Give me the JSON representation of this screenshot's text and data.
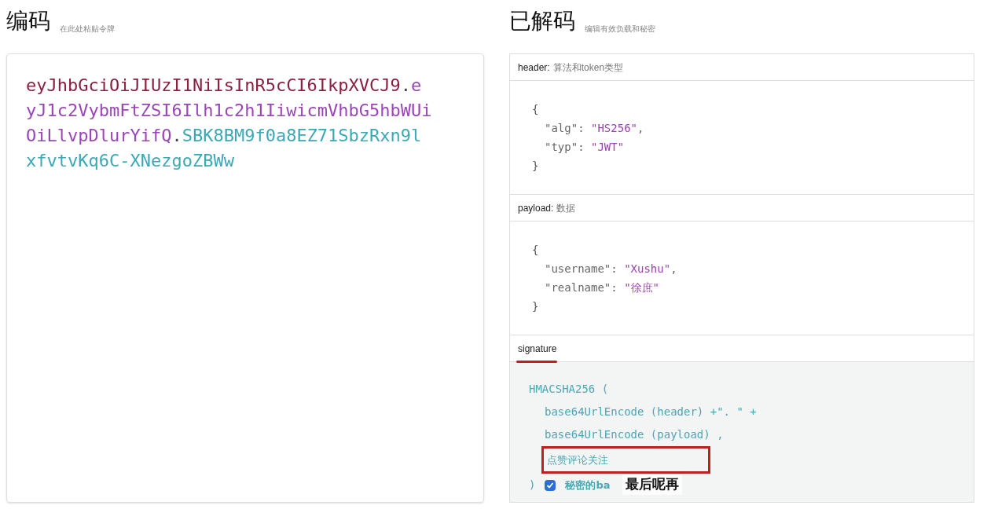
{
  "encoded": {
    "title": "编码",
    "hint": "在此处粘贴令牌",
    "token_parts": [
      {
        "kind": "header",
        "text": "eyJhbGciOiJIUzI1NiIsInR5cCI6IkpXVCJ9"
      },
      {
        "kind": "dot",
        "text": "."
      },
      {
        "kind": "payload",
        "text": "eyJ1c2VybmFtZSI6Ilh1c2h1IiwicmVhbG5hbWUiOiLlvpDlurYifQ"
      },
      {
        "kind": "dot",
        "text": "."
      },
      {
        "kind": "signature",
        "text": "SBK8BM9f0a8EZ71SbzRxn9lxfvtvKq6C-XNezgoZBWw"
      }
    ]
  },
  "decoded": {
    "title": "已解码",
    "hint": "编辑有效负载和秘密",
    "sections": [
      {
        "kind": "json",
        "label": "header:",
        "hint": "算法和token类型",
        "underlined": false,
        "lines": [
          {
            "kind": "brace",
            "text": "{"
          },
          {
            "kind": "entry",
            "key": "\"alg\"",
            "sep": ": ",
            "value": "\"HS256\"",
            "end": ","
          },
          {
            "kind": "entry",
            "key": "\"typ\"",
            "sep": ": ",
            "value": "\"JWT\""
          },
          {
            "kind": "brace",
            "text": "}"
          }
        ]
      },
      {
        "kind": "json",
        "label": "payload:",
        "hint": "数据",
        "underlined": false,
        "lines": [
          {
            "kind": "brace",
            "text": "{"
          },
          {
            "kind": "entry",
            "key": "\"username\"",
            "sep": ": ",
            "value": "\"Xushu\"",
            "end": ","
          },
          {
            "kind": "entry",
            "key": "\"realname\"",
            "sep": ": ",
            "value": "\"徐庶\""
          },
          {
            "kind": "brace",
            "text": "}"
          }
        ]
      },
      {
        "kind": "signature",
        "label": "signature",
        "underlined": true,
        "lines": [
          "HMACSHA256 (",
          "base64UrlEncode (header) +\". \" +",
          "base64UrlEncode (payload) ,"
        ],
        "secret": {
          "value": "点赞评论关注",
          "highlighted": true
        },
        "close": ")",
        "checkbox": {
          "label": "秘密的ba",
          "checked": true
        }
      }
    ]
  },
  "subtitle": "最后呢再"
}
